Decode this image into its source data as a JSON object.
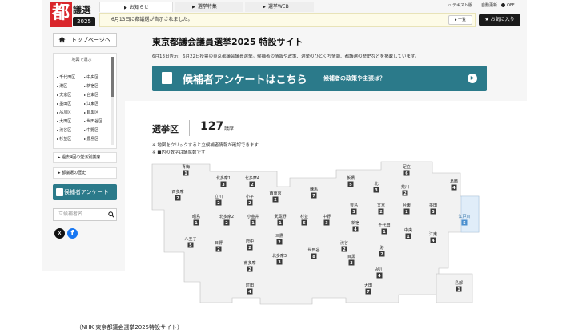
{
  "logo": {
    "kanji": "都",
    "words": "議選",
    "year": "2025"
  },
  "top_nav": {
    "notice": "お知らせ",
    "tokushu": "選挙特集",
    "web": "選挙WEB"
  },
  "notice_bar": {
    "text": "6月13日に都議選が告示されました。",
    "list_btn": "一覧"
  },
  "top_links": {
    "text_version": "テキスト版",
    "auto_update": "自動更新",
    "off": "OFF",
    "favorite": "お気に入り"
  },
  "sidebar": {
    "home": "トップページへ",
    "region_title": "地図で選ぶ",
    "wards": [
      "千代田区",
      "中央区",
      "港区",
      "新宿区",
      "文京区",
      "台東区",
      "墨田区",
      "江東区",
      "品川区",
      "目黒区",
      "大田区",
      "世田谷区",
      "渋谷区",
      "中野区",
      "杉並区",
      "豊島区"
    ],
    "links": [
      "過去4回の党派別議席",
      "都議選の歴史"
    ],
    "survey": "候補者アンケート",
    "search_placeholder": "立候補者名"
  },
  "header": {
    "title": "東京都議会議員選挙2025 特設サイト",
    "description": "6月13日告示、6月22日投票の東京都議会議員選挙。候補者の情報や政策、選挙のひとくち情報、都議選の歴史などを掲載しています。"
  },
  "banner": {
    "title": "候補者アンケートはこちら",
    "sub": "候補者の政策や主張は？"
  },
  "district": {
    "heading": "選挙区",
    "count": "127",
    "unit": "議席",
    "note1": "※ 地図をクリックすると立候補者情報が確認できます",
    "note2": "※ ■内の数字は議席数です"
  },
  "map_districts": [
    {
      "name": "青梅",
      "seats": "1"
    },
    {
      "name": "北多摩1",
      "seats": "3"
    },
    {
      "name": "北多摩4",
      "seats": "2"
    },
    {
      "name": "西多摩",
      "seats": "2"
    },
    {
      "name": "立川",
      "seats": "2"
    },
    {
      "name": "小平",
      "seats": "2"
    },
    {
      "name": "西東京",
      "seats": "2"
    },
    {
      "name": "練馬",
      "seats": "7"
    },
    {
      "name": "板橋",
      "seats": "5"
    },
    {
      "name": "北",
      "seats": "3"
    },
    {
      "name": "足立",
      "seats": "6"
    },
    {
      "name": "荒川",
      "seats": "2"
    },
    {
      "name": "葛飾",
      "seats": "4"
    },
    {
      "name": "昭島",
      "seats": "1"
    },
    {
      "name": "北多摩2",
      "seats": "2"
    },
    {
      "name": "小金井",
      "seats": "1"
    },
    {
      "name": "武蔵野",
      "seats": "1"
    },
    {
      "name": "杉並",
      "seats": "6"
    },
    {
      "name": "中野",
      "seats": "3"
    },
    {
      "name": "豊島",
      "seats": "3"
    },
    {
      "name": "文京",
      "seats": "2"
    },
    {
      "name": "台東",
      "seats": "2"
    },
    {
      "name": "墨田",
      "seats": "3"
    },
    {
      "name": "江戸川",
      "seats": "5",
      "highlight": true
    },
    {
      "name": "新宿",
      "seats": "4"
    },
    {
      "name": "千代田",
      "seats": "1"
    },
    {
      "name": "八王子",
      "seats": "5"
    },
    {
      "name": "日野",
      "seats": "2"
    },
    {
      "name": "府中",
      "seats": "2"
    },
    {
      "name": "三鷹",
      "seats": "2"
    },
    {
      "name": "中央",
      "seats": "1"
    },
    {
      "name": "江東",
      "seats": "4"
    },
    {
      "name": "渋谷",
      "seats": "2"
    },
    {
      "name": "港",
      "seats": "2"
    },
    {
      "name": "北多摩3",
      "seats": "3"
    },
    {
      "name": "世田谷",
      "seats": "8"
    },
    {
      "name": "目黒",
      "seats": "3"
    },
    {
      "name": "南多摩",
      "seats": "2"
    },
    {
      "name": "品川",
      "seats": "4"
    },
    {
      "name": "町田",
      "seats": "4"
    },
    {
      "name": "大田",
      "seats": "7"
    },
    {
      "name": "島部",
      "seats": "1"
    }
  ],
  "footer_caption": "（NHK 東京都議会選挙2025特設サイト）"
}
